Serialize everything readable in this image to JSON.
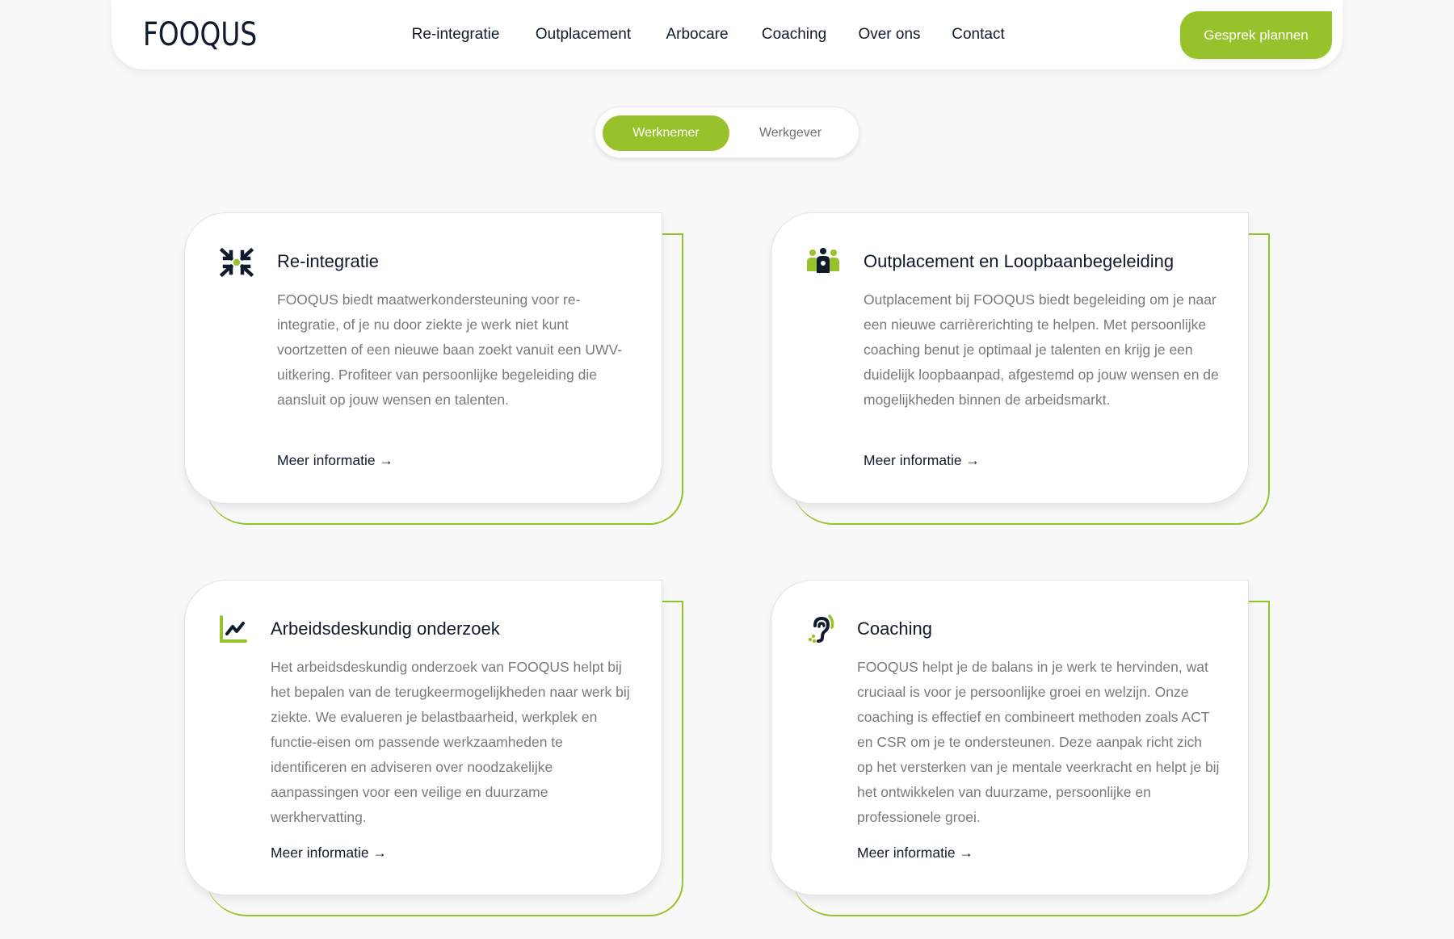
{
  "header": {
    "logo": "FOOQUS",
    "nav": [
      {
        "label": "Re-integratie"
      },
      {
        "label": "Outplacement"
      },
      {
        "label": "Arbocare"
      },
      {
        "label": "Coaching"
      },
      {
        "label": "Over ons"
      },
      {
        "label": "Contact"
      }
    ],
    "cta_label": "Gesprek plannen"
  },
  "toggle": {
    "options": [
      {
        "label": "Werknemer",
        "active": true
      },
      {
        "label": "Werkgever",
        "active": false
      }
    ]
  },
  "cards": [
    {
      "icon": "arrows-converge-icon",
      "title": "Re-integratie",
      "body": "FOOQUS biedt maatwerkondersteuning voor re-integratie, of je nu door ziekte je werk niet kunt voortzetten of een nieuwe baan zoekt vanuit een UWV-uitkering. Profiteer van persoonlijke begeleiding die aansluit op jouw wensen en talenten.",
      "link": "Meer informatie →"
    },
    {
      "icon": "group-people-icon",
      "title": "Outplacement en Loopbaanbegeleiding",
      "body": "Outplacement bij FOOQUS biedt begeleiding om je naar een nieuwe carrièrerichting te helpen. Met persoonlijke coaching benut je optimaal je talenten en krijg je een duidelijk loopbaanpad, afgestemd op jouw wensen en de mogelijkheden binnen de arbeidsmarkt.",
      "link": "Meer informatie →"
    },
    {
      "icon": "line-chart-icon",
      "title": "Arbeidsdeskundig onderzoek",
      "body": "Het arbeidsdeskundig onderzoek van FOOQUS helpt bij het bepalen van de terugkeermogelijkheden naar werk bij ziekte. We evalueren je belastbaarheid, werkplek en functie-eisen om passende werkzaamheden te identificeren en adviseren over noodzakelijke aanpassingen voor een veilige en duurzame werkhervatting.",
      "link": "Meer informatie →"
    },
    {
      "icon": "ear-listening-icon",
      "title": "Coaching",
      "body": "FOOQUS helpt je de balans in je werk te hervinden, wat cruciaal is voor je persoonlijke groei en welzijn. Onze coaching is effectief en combineert methoden zoals ACT en CSR om je te ondersteunen. Deze aanpak richt zich op het versterken van je mentale veerkracht en helpt je bij het ontwikkelen van duurzame, persoonlijke en professionele groei.",
      "link": "Meer informatie →"
    }
  ],
  "colors": {
    "accent": "#98c22b",
    "text_dark": "#0f1b2d",
    "text_muted": "#7a7a7a",
    "background": "#f8f8f8"
  }
}
